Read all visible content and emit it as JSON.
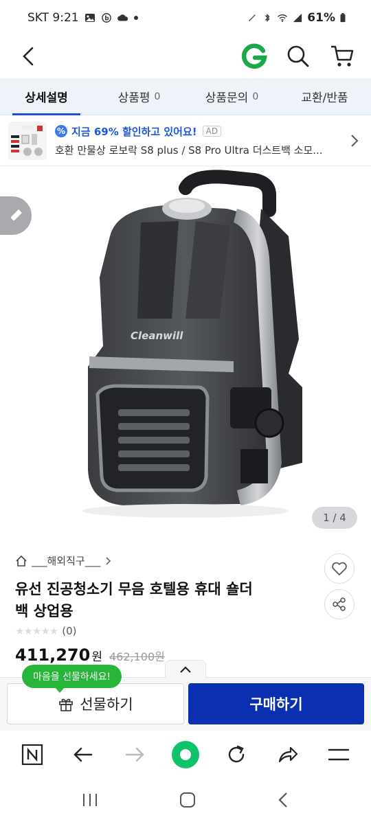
{
  "status_bar": {
    "carrier_time": "SKT 9:21",
    "battery": "61%"
  },
  "header": {
    "icons": [
      "back-arrow-icon",
      "gmarket-g-logo",
      "search-icon",
      "cart-icon"
    ],
    "accent_color": "#1aa84a"
  },
  "tabs": [
    {
      "label": "상세설명",
      "count": ""
    },
    {
      "label": "상품평",
      "count": "0"
    },
    {
      "label": "상품문의",
      "count": "0"
    },
    {
      "label": "교환/반품",
      "count": ""
    }
  ],
  "ad": {
    "headline": "지금 69% 할인하고 있어요!",
    "tag": "AD",
    "description": "호환 만물상 로보락 S8 plus / S8 Pro Ultra 더스트백 소모..."
  },
  "gallery": {
    "brand_on_product": "Cleanwill",
    "counter": "1 / 4"
  },
  "product": {
    "category": "___해외직구___",
    "title_line1": "유선 진공청소기 무음 호텔용 휴대 숄더",
    "title_line2": "백 상업용",
    "rating_count": "(0)",
    "price": "411,270",
    "price_unit": "원",
    "original_price": "462,100원"
  },
  "buy_bar": {
    "gift_bubble": "마음을 선물하세요!",
    "gift_label": "선물하기",
    "buy_label": "구매하기",
    "buy_color": "#0a2fb0"
  },
  "toolbar": {
    "icons": [
      "naver-n-icon",
      "back-icon",
      "forward-icon",
      "home-circle-icon",
      "reload-icon",
      "share-icon",
      "menu-icon"
    ]
  },
  "system_nav": {
    "icons": [
      "recents-icon",
      "home-icon",
      "back-icon"
    ]
  }
}
